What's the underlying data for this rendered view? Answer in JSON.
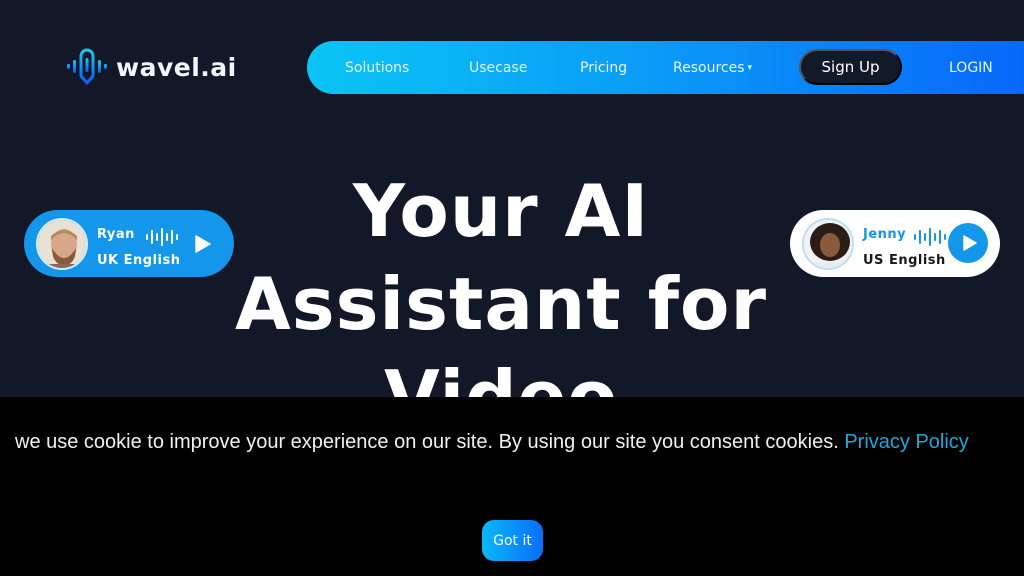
{
  "brand": {
    "name": "wavel.ai",
    "logo_icon": "soundwave-pen-icon"
  },
  "nav": {
    "items": [
      {
        "label": "Solutions"
      },
      {
        "label": "Usecase"
      },
      {
        "label": "Pricing"
      },
      {
        "label": "Resources",
        "has_dropdown": true,
        "caret": "▾"
      }
    ],
    "signup_label": "Sign Up",
    "login_label": "LOGIN"
  },
  "hero": {
    "line1": "Your AI",
    "line2": "Assistant for",
    "line3": "Video"
  },
  "voices": [
    {
      "name": "Ryan",
      "language": "UK English",
      "icon": "play-icon",
      "wave_icon": "soundwave-icon"
    },
    {
      "name": "Jenny",
      "language": "US English",
      "icon": "play-icon",
      "wave_icon": "soundwave-icon"
    }
  ],
  "cookie": {
    "message": "we use cookie to improve your experience on our site. By using our site you consent cookies. ",
    "link_label": "Privacy Policy",
    "button_label": "Got it"
  },
  "colors": {
    "background": "#131828",
    "nav_gradient_start": "#0bc4f5",
    "nav_gradient_end": "#0866fb",
    "accent_blue": "#1496ea",
    "cookie_bg": "#000000",
    "link": "#1ea8d8"
  }
}
